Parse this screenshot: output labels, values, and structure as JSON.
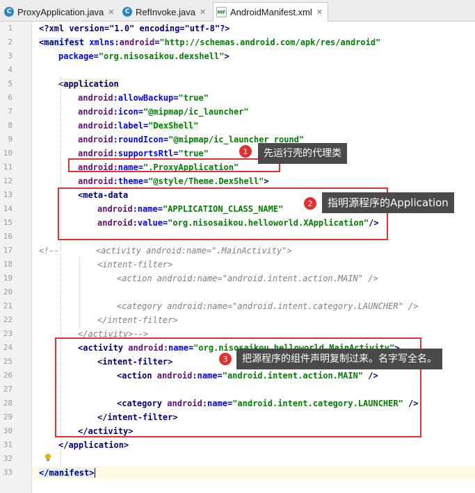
{
  "tabs": [
    {
      "label": "ProxyApplication.java",
      "icon": "C"
    },
    {
      "label": "RefInvoke.java",
      "icon": "C"
    },
    {
      "label": "AndroidManifest.xml",
      "icon": "MF"
    }
  ],
  "line_numbers": [
    "1",
    "2",
    "3",
    "4",
    "5",
    "6",
    "7",
    "8",
    "9",
    "10",
    "11",
    "12",
    "13",
    "14",
    "15",
    "16",
    "17",
    "18",
    "19",
    "20",
    "21",
    "22",
    "23",
    "24",
    "25",
    "26",
    "27",
    "28",
    "29",
    "30",
    "31",
    "32",
    "33"
  ],
  "code": {
    "l1": [
      "<?xml version=\"1.0\" encoding=\"utf-8\"?>"
    ],
    "l2": [
      "<manifest",
      " xmlns:",
      "android",
      "=",
      "\"http://schemas.android.com/apk/res/android\""
    ],
    "l3": [
      "package",
      "=",
      "\"org.nisosaikou.dexshell\"",
      ">"
    ],
    "l5": [
      "<",
      "application"
    ],
    "l6": [
      "android",
      ":allowBackup",
      "=",
      "\"true\""
    ],
    "l7": [
      "android",
      ":icon",
      "=",
      "\"@mipmap/ic_launcher\""
    ],
    "l8": [
      "android",
      ":label",
      "=",
      "\"DexShell\""
    ],
    "l9": [
      "android",
      ":roundIcon",
      "=",
      "\"@mipmap/ic_launcher_round\""
    ],
    "l10": [
      "android",
      ":supportsRtl",
      "=",
      "\"true\""
    ],
    "l11": [
      "android",
      ":name",
      "=",
      "\".ProxyApplication\""
    ],
    "l12": [
      "android",
      ":theme",
      "=",
      "\"@style/Theme.DexShell\"",
      ">"
    ],
    "l13": [
      "<meta-data"
    ],
    "l14": [
      "android",
      ":name",
      "=",
      "\"APPLICATION_CLASS_NAME\""
    ],
    "l15": [
      "android",
      ":value",
      "=",
      "\"org.nisosaikou.helloworld.XApplication\"",
      "/>"
    ],
    "l17a": "<!--",
    "l17b": "<activity android:name=\".MainActivity\">",
    "l18": "<intent-filter>",
    "l19": "<action android:name=\"android.intent.action.MAIN\" />",
    "l21": "<category android:name=\"android.intent.category.LAUNCHER\" />",
    "l22": "</intent-filter>",
    "l23": "</activity>-->",
    "l24": [
      "<activity",
      " android",
      ":name",
      "=",
      "\"org.nisosaikou.helloworld.MainActivity\"",
      ">"
    ],
    "l25": [
      "<intent-filter>"
    ],
    "l26": [
      "<action",
      " android",
      ":name",
      "=",
      "\"android.intent.action.MAIN\"",
      " />"
    ],
    "l28": [
      "<category",
      " android",
      ":name",
      "=",
      "\"android.intent.category.LAUNCHER\"",
      " />"
    ],
    "l29": [
      "</intent-filter>"
    ],
    "l30": [
      "</activity>"
    ],
    "l31": [
      "</application>"
    ],
    "l33": [
      "</manifest>"
    ]
  },
  "annotations": [
    {
      "num": "1",
      "text": "先运行壳的代理类"
    },
    {
      "num": "2",
      "text": "指明源程序的Application"
    },
    {
      "num": "3",
      "text": "把源程序的组件声明复制过来。名字写全名。"
    }
  ],
  "colors": {
    "accent_red": "#e03030",
    "callout_bg": "#4a4a4a",
    "tag": "#000080",
    "attr": "#0000ff",
    "value": "#008000",
    "namespace": "#660e7a"
  }
}
